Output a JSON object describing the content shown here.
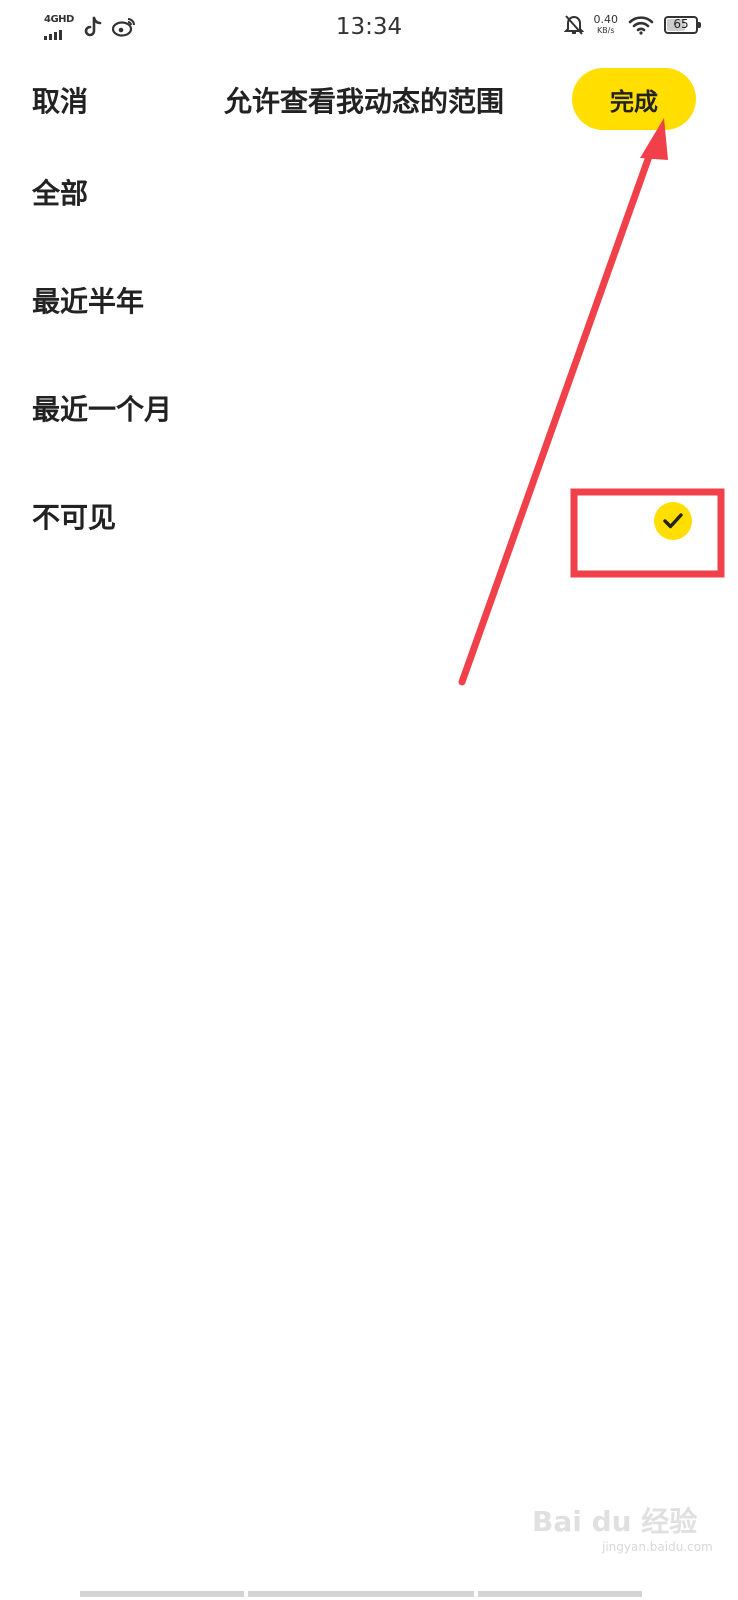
{
  "status_bar": {
    "network_type": "4GHD",
    "time": "13:34",
    "speed_value": "0.40",
    "speed_unit": "KB/s",
    "battery_level": "65",
    "icons": [
      "signal-bars-icon",
      "tiktok-icon",
      "weibo-icon",
      "bell-off-icon",
      "wifi-icon",
      "battery-icon"
    ]
  },
  "header": {
    "cancel_label": "取消",
    "title": "允许查看我动态的范围",
    "done_label": "完成"
  },
  "options": [
    {
      "label": "全部",
      "selected": false
    },
    {
      "label": "最近半年",
      "selected": false
    },
    {
      "label": "最近一个月",
      "selected": false
    },
    {
      "label": "不可见",
      "selected": true
    }
  ],
  "colors": {
    "accent": "#ffde00",
    "annotation": "#f0414b",
    "text": "#222222"
  },
  "watermark": {
    "logo_text": "Bai du 经验",
    "sub_text": "jingyan.baidu.com"
  }
}
